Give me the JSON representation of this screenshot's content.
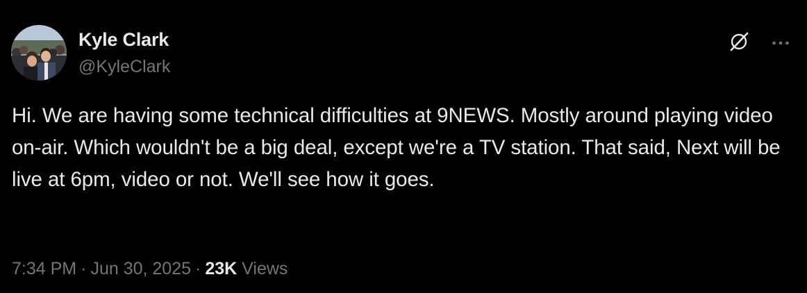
{
  "tweet": {
    "author": {
      "display_name": "Kyle Clark",
      "handle": "@KyleClark"
    },
    "icons": {
      "grok": "grok-icon",
      "more": "more-icon"
    },
    "text": "Hi. We are having some technical difficulties at 9NEWS. Mostly around playing video on-air. Which wouldn't be a big deal, except we're a TV station. That said, Next will be live at 6pm, video or not. We'll see how it goes.",
    "time": "7:34 PM",
    "date": "Jun 30, 2025",
    "separator": "·",
    "views_count": "23K",
    "views_label": "Views"
  },
  "colors": {
    "background": "#000000",
    "primary_text": "#e7e9ea",
    "secondary_text": "#71767b"
  }
}
